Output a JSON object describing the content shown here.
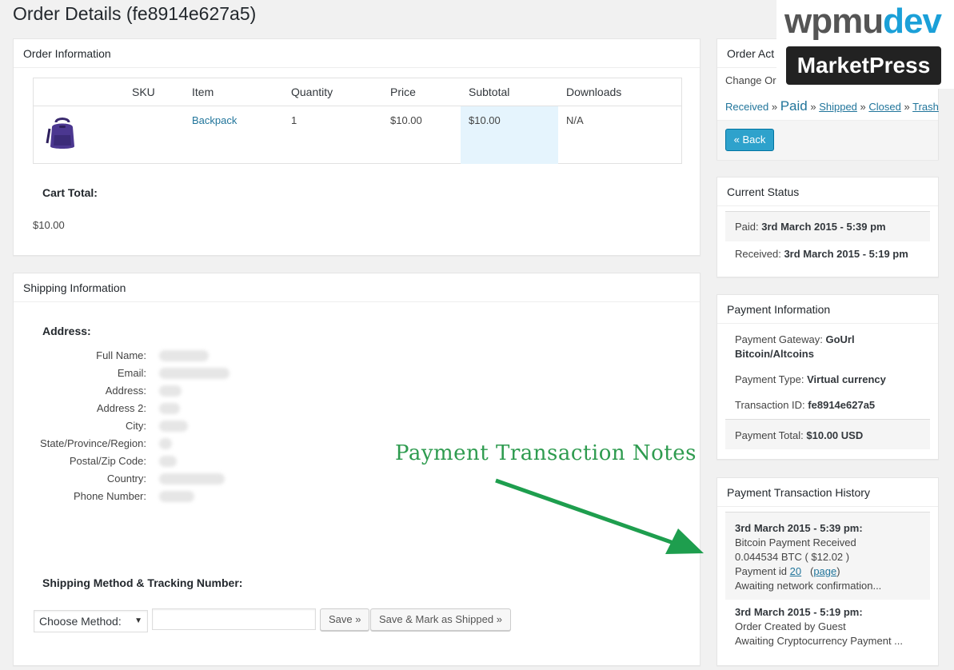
{
  "page": {
    "title": "Order Details (fe8914e627a5)"
  },
  "logo": {
    "brand_a": "wpmu",
    "brand_b": "dev",
    "product": "MarketPress"
  },
  "order_info": {
    "heading": "Order Information",
    "columns": [
      "SKU",
      "Item",
      "Quantity",
      "Price",
      "Subtotal",
      "Downloads"
    ],
    "row": {
      "sku": "",
      "item": "Backpack",
      "quantity": "1",
      "price": "$10.00",
      "subtotal": "$10.00",
      "downloads": "N/A"
    },
    "cart_total_label": "Cart Total:",
    "cart_total_value": "$10.00"
  },
  "shipping": {
    "heading": "Shipping Information",
    "address_heading": "Address:",
    "fields": [
      "Full Name:",
      "Email:",
      "Address:",
      "Address 2:",
      "City:",
      "State/Province/Region:",
      "Postal/Zip Code:",
      "Country:",
      "Phone Number:"
    ],
    "method_heading": "Shipping Method & Tracking Number:",
    "method_select": "Choose Method:",
    "save_label": "Save »",
    "save_ship_label": "Save & Mark as Shipped »"
  },
  "order_actions": {
    "heading": "Order Act",
    "change_label": "Change Or",
    "statuses": {
      "received": "Received",
      "paid": "Paid",
      "shipped": "Shipped",
      "closed": "Closed",
      "trash": "Trash",
      "sep": "»"
    },
    "back_label": "« Back"
  },
  "current_status": {
    "heading": "Current Status",
    "paid_label": "Paid:",
    "paid_value": "3rd March 2015 - 5:39 pm",
    "received_label": "Received:",
    "received_value": "3rd March 2015 - 5:19 pm"
  },
  "payment_info": {
    "heading": "Payment Information",
    "gateway_label": "Payment Gateway:",
    "gateway_value_1": "GoUrl",
    "gateway_value_2": "Bitcoin/Altcoins",
    "type_label": "Payment Type:",
    "type_value": "Virtual currency",
    "txn_label": "Transaction ID:",
    "txn_value": "fe8914e627a5",
    "total_label": "Payment Total:",
    "total_value": "$10.00 USD"
  },
  "txn_history": {
    "heading": "Payment Transaction History",
    "entry1": {
      "date": "3rd March 2015 - 5:39 pm:",
      "line1": "Bitcoin Payment Received",
      "line2": "0.044534 BTC  ( $12.02 )",
      "line3_prefix": "Payment id",
      "line3_id": "20",
      "line3_page": "page",
      "line4": "Awaiting network confirmation..."
    },
    "entry2": {
      "date": "3rd March 2015 - 5:19 pm:",
      "line1": "Order Created by Guest",
      "line2": "Awaiting Cryptocurrency Payment ..."
    }
  },
  "annotation": {
    "text": "Payment Transaction Notes",
    "color": "#2e9b4f"
  }
}
